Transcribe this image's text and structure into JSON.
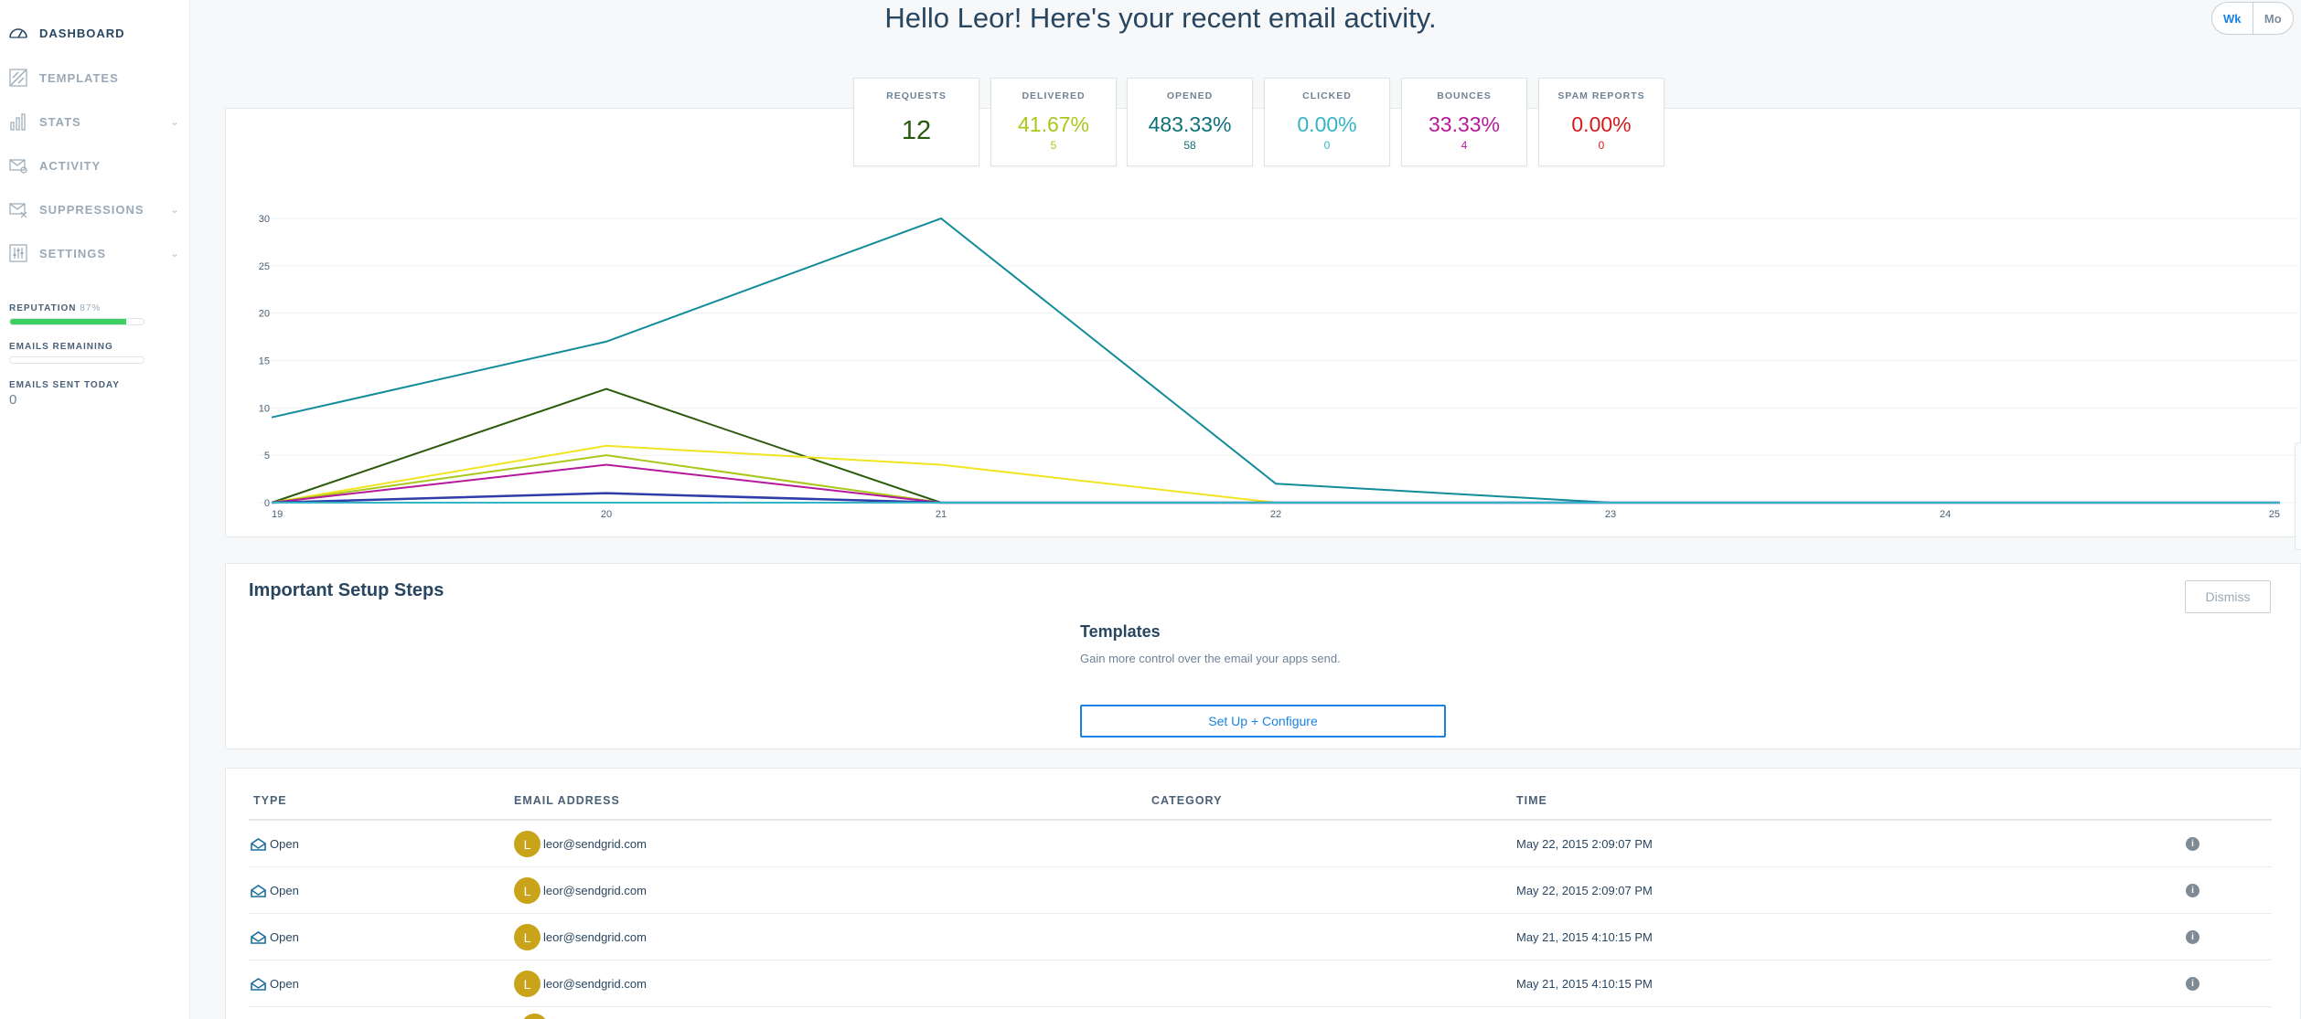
{
  "sidebar": {
    "items": [
      {
        "label": "DASHBOARD",
        "icon": "dashboard-icon",
        "active": true
      },
      {
        "label": "TEMPLATES",
        "icon": "templates-icon"
      },
      {
        "label": "STATS",
        "icon": "stats-icon",
        "expandable": true
      },
      {
        "label": "ACTIVITY",
        "icon": "activity-icon"
      },
      {
        "label": "SUPPRESSIONS",
        "icon": "suppressions-icon",
        "expandable": true
      },
      {
        "label": "SETTINGS",
        "icon": "settings-icon",
        "expandable": true
      }
    ],
    "reputation_label": "REPUTATION",
    "reputation_value": "87%",
    "reputation_fill": 0.87,
    "emails_remaining_label": "EMAILS REMAINING",
    "emails_sent_label": "EMAILS SENT TODAY",
    "emails_sent_value": "0"
  },
  "header": {
    "title": "Hello Leor! Here's your recent email activity.",
    "range_toggle": [
      "Wk",
      "Mo"
    ],
    "range_selected": "Wk"
  },
  "stats": [
    {
      "label": "REQUESTS",
      "value": "12",
      "sub": "",
      "color": "#2b5a0d"
    },
    {
      "label": "DELIVERED",
      "value": "41.67%",
      "sub": "5",
      "color": "#a9c819"
    },
    {
      "label": "OPENED",
      "value": "483.33%",
      "sub": "58",
      "color": "#0e6f78"
    },
    {
      "label": "CLICKED",
      "value": "0.00%",
      "sub": "0",
      "color": "#35b4c6"
    },
    {
      "label": "BOUNCES",
      "value": "33.33%",
      "sub": "4",
      "color": "#b5199b"
    },
    {
      "label": "SPAM REPORTS",
      "value": "0.00%",
      "sub": "0",
      "color": "#d7191c"
    }
  ],
  "chart_data": {
    "type": "line",
    "x": [
      19,
      20,
      21,
      22,
      23,
      24,
      25
    ],
    "ylim": [
      0,
      30
    ],
    "yticks": [
      0,
      5,
      10,
      15,
      20,
      25,
      30
    ],
    "grid": true,
    "series": [
      {
        "values": [
          9,
          17,
          30,
          2,
          0,
          0,
          0
        ],
        "color": "#138c9a"
      },
      {
        "values": [
          0,
          12,
          0,
          0,
          0,
          0,
          0
        ],
        "color": "#2b5a0d"
      },
      {
        "values": [
          0,
          6,
          4,
          0,
          0,
          0,
          0
        ],
        "color": "#f1e420"
      },
      {
        "values": [
          0,
          5,
          0,
          0,
          0,
          0,
          0
        ],
        "color": "#a9c819"
      },
      {
        "values": [
          0,
          4,
          0,
          0,
          0,
          0,
          0
        ],
        "color": "#b5199b"
      },
      {
        "values": [
          0,
          1,
          0,
          0,
          0,
          0,
          0
        ],
        "color": "#2e3da8"
      },
      {
        "values": [
          0,
          0,
          0,
          0,
          0,
          0,
          0
        ],
        "color": "#35b4c6"
      }
    ]
  },
  "setup": {
    "title": "Important Setup Steps",
    "dismiss_label": "Dismiss",
    "step_title": "Templates",
    "step_desc": "Gain more control over the email your apps send.",
    "button_label": "Set Up + Configure"
  },
  "activity": {
    "headers": [
      "TYPE",
      "EMAIL ADDRESS",
      "CATEGORY",
      "TIME"
    ],
    "rows": [
      {
        "type": "Open",
        "avatar": "L",
        "email": "leor@sendgrid.com",
        "category": "",
        "time": "May 22, 2015 2:09:07 PM"
      },
      {
        "type": "Open",
        "avatar": "L",
        "email": "leor@sendgrid.com",
        "category": "",
        "time": "May 22, 2015 2:09:07 PM"
      },
      {
        "type": "Open",
        "avatar": "L",
        "email": "leor@sendgrid.com",
        "category": "",
        "time": "May 21, 2015 4:10:15 PM"
      },
      {
        "type": "Open",
        "avatar": "L",
        "email": "leor@sendgrid.com",
        "category": "",
        "time": "May 21, 2015 4:10:15 PM"
      }
    ],
    "info_icon": "info-icon",
    "type_icon": "open-envelope-icon"
  }
}
